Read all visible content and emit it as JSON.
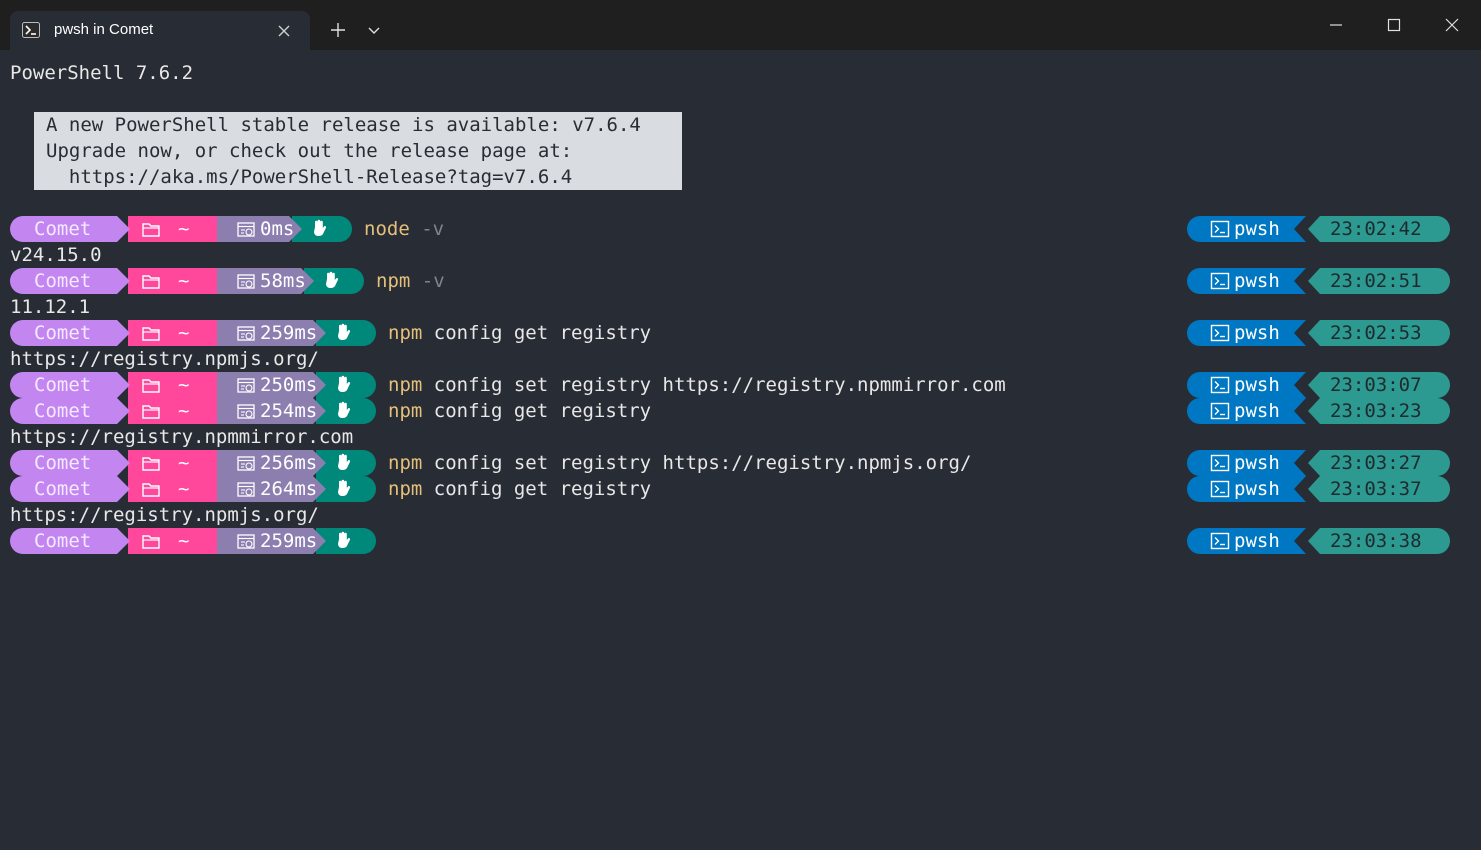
{
  "window": {
    "tab_title": "pwsh in Comet",
    "tab_icon": "powershell-icon"
  },
  "colors": {
    "comet": "#c386f1",
    "path": "#ff479c",
    "time": "#8d7eb0",
    "status": "#00897b",
    "shell": "#0077c2",
    "clock": "#2d9a92",
    "command": "#e5c07b",
    "flag": "#7f848e"
  },
  "terminal": {
    "header": "PowerShell 7.6.2",
    "banner": [
      "A new PowerShell stable release is available: v7.6.4",
      "Upgrade now, or check out the release page at:",
      "  https://aka.ms/PowerShell-Release?tag=v7.6.4"
    ],
    "prompts": [
      {
        "user": "Comet",
        "path": "~",
        "duration": "0ms",
        "command": "node",
        "args": "-v",
        "args_style": "flag",
        "shell": "pwsh",
        "clock": "23:02:42",
        "output": "v24.15.0"
      },
      {
        "user": "Comet",
        "path": "~",
        "duration": "58ms",
        "command": "npm",
        "args": "-v",
        "args_style": "flag",
        "shell": "pwsh",
        "clock": "23:02:51",
        "output": "11.12.1"
      },
      {
        "user": "Comet",
        "path": "~",
        "duration": "259ms",
        "command": "npm",
        "args": "config get registry",
        "args_style": "plain",
        "shell": "pwsh",
        "clock": "23:02:53",
        "output": "https://registry.npmjs.org/"
      },
      {
        "user": "Comet",
        "path": "~",
        "duration": "250ms",
        "command": "npm",
        "args": "config set registry https://registry.npmmirror.com",
        "args_style": "plain",
        "shell": "pwsh",
        "clock": "23:03:07",
        "output": ""
      },
      {
        "user": "Comet",
        "path": "~",
        "duration": "254ms",
        "command": "npm",
        "args": "config get registry",
        "args_style": "plain",
        "shell": "pwsh",
        "clock": "23:03:23",
        "output": "https://registry.npmmirror.com"
      },
      {
        "user": "Comet",
        "path": "~",
        "duration": "256ms",
        "command": "npm",
        "args": "config set registry https://registry.npmjs.org/",
        "args_style": "plain",
        "shell": "pwsh",
        "clock": "23:03:27",
        "output": ""
      },
      {
        "user": "Comet",
        "path": "~",
        "duration": "264ms",
        "command": "npm",
        "args": "config get registry",
        "args_style": "plain",
        "shell": "pwsh",
        "clock": "23:03:37",
        "output": "https://registry.npmjs.org/"
      },
      {
        "user": "Comet",
        "path": "~",
        "duration": "259ms",
        "command": "",
        "args": "",
        "args_style": "plain",
        "shell": "pwsh",
        "clock": "23:03:38",
        "output": ""
      }
    ]
  }
}
